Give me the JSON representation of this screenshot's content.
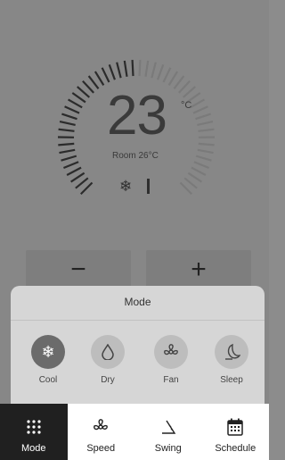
{
  "thermostat": {
    "set_temp": "23",
    "unit": "°C",
    "room_temp": "Room 26°C",
    "mode_icon": "snowflake-icon"
  },
  "adjust": {
    "minus": "−",
    "plus": "+"
  },
  "mode_sheet": {
    "title": "Mode",
    "options": [
      {
        "label": "Cool",
        "icon": "snowflake-icon",
        "selected": true
      },
      {
        "label": "Dry",
        "icon": "droplet-icon",
        "selected": false
      },
      {
        "label": "Fan",
        "icon": "fan-icon",
        "selected": false
      },
      {
        "label": "Sleep",
        "icon": "moon-icon",
        "selected": false
      }
    ]
  },
  "tabs": [
    {
      "label": "Mode",
      "icon": "grid-icon",
      "active": true
    },
    {
      "label": "Speed",
      "icon": "fan-icon",
      "active": false
    },
    {
      "label": "Swing",
      "icon": "swing-icon",
      "active": false
    },
    {
      "label": "Schedule",
      "icon": "calendar-icon",
      "active": false
    }
  ],
  "colors": {
    "overlay": "#878787",
    "sheet": "#d6d6d6",
    "active_tab": "#202020",
    "selected_mode": "#6b6b6b"
  }
}
